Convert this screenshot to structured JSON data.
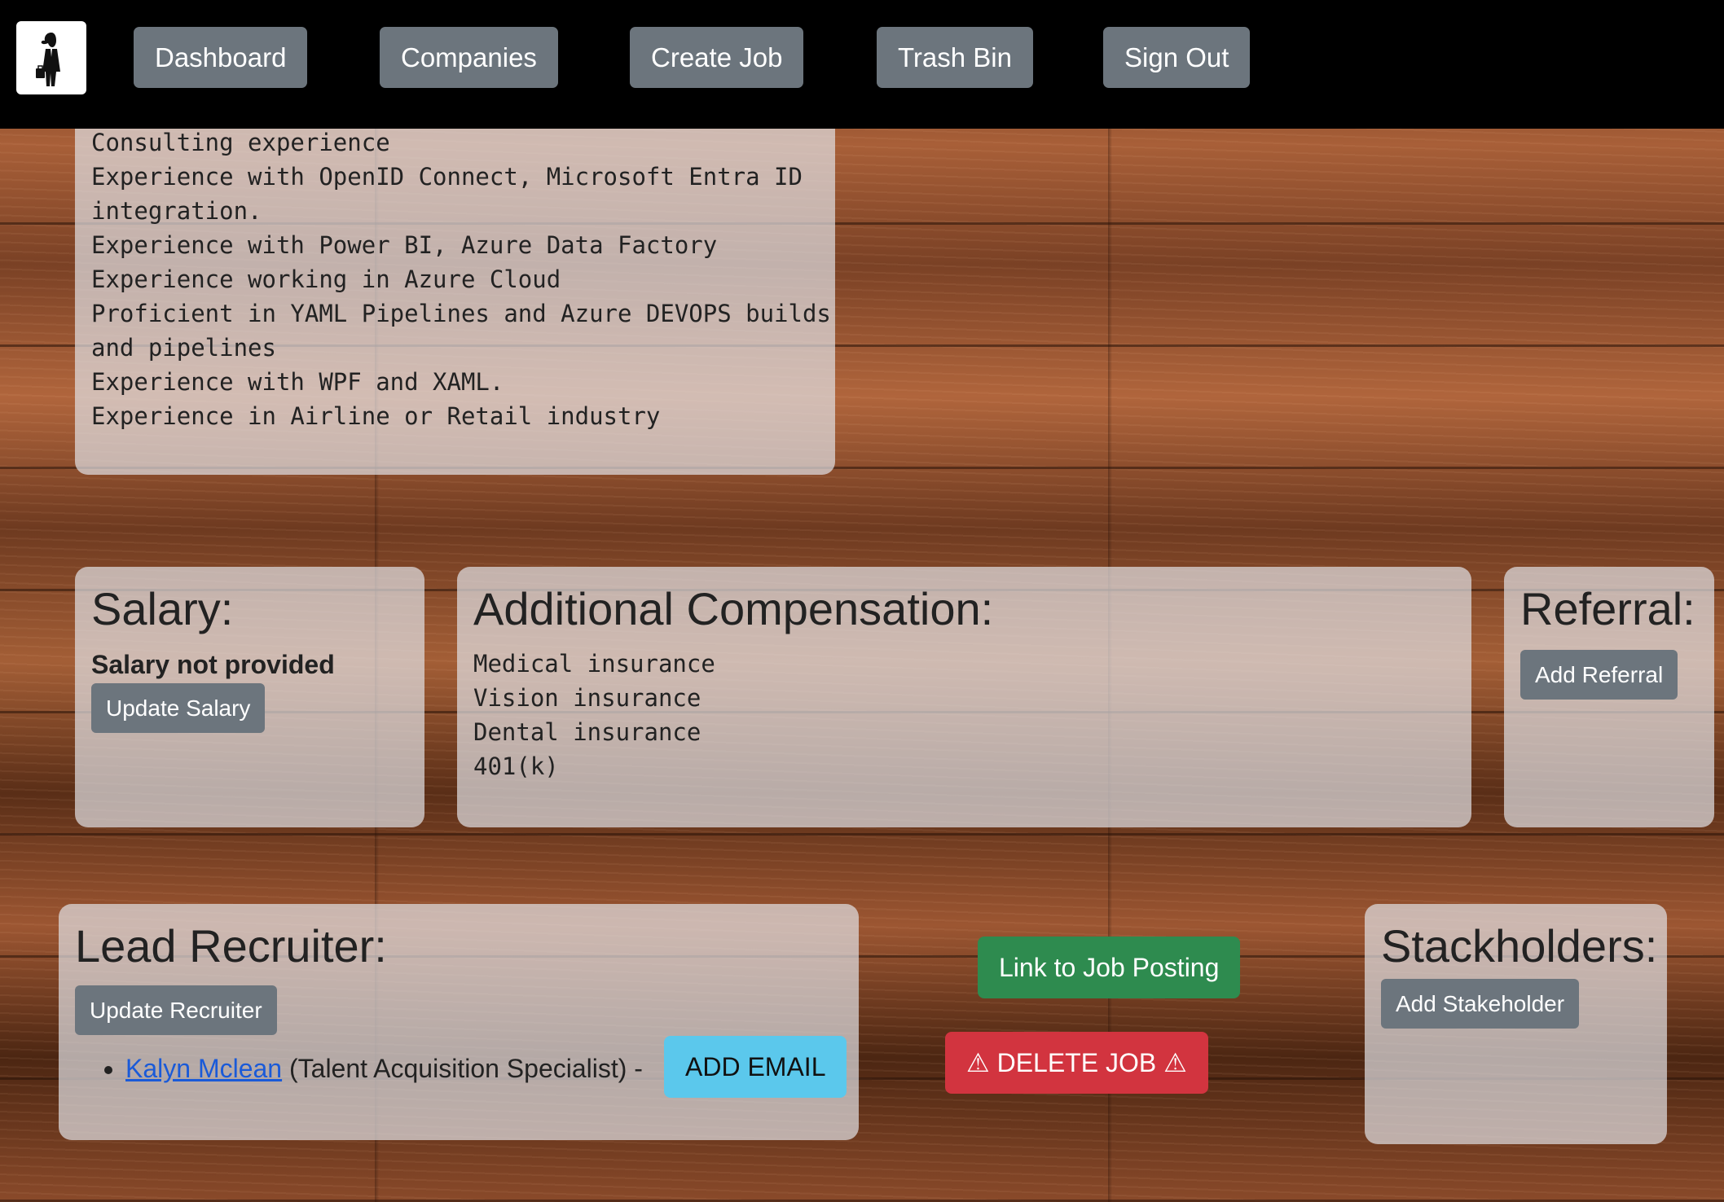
{
  "nav": {
    "logo_icon": "businessman-logo-icon",
    "items": [
      {
        "label": "Dashboard"
      },
      {
        "label": "Companies"
      },
      {
        "label": "Create Job"
      },
      {
        "label": "Trash Bin"
      },
      {
        "label": "Sign Out"
      }
    ]
  },
  "qualifications": {
    "lines": [
      "Consulting experience",
      "Experience with OpenID Connect, Microsoft Entra ID",
      "integration.",
      "Experience with Power BI, Azure Data Factory",
      "Experience working in Azure Cloud",
      "Proficient in YAML Pipelines and Azure DEVOPS builds",
      "and pipelines",
      "Experience with WPF and XAML.",
      "Experience in Airline or Retail industry"
    ]
  },
  "salary": {
    "title": "Salary:",
    "note": "Salary not provided",
    "button": "Update Salary"
  },
  "compensation": {
    "title": "Additional Compensation:",
    "items": [
      "Medical insurance",
      "Vision insurance",
      "Dental insurance",
      "401(k)"
    ]
  },
  "referral": {
    "title": "Referral:",
    "button": "Add Referral"
  },
  "recruiter": {
    "title": "Lead Recruiter:",
    "button": "Update Recruiter",
    "name": "Kalyn Mclean",
    "role": " (Talent Acquisition Specialist) -",
    "email_button": "ADD EMAIL"
  },
  "actions": {
    "link_button": "Link to Job Posting",
    "delete_button": "⚠ DELETE JOB ⚠"
  },
  "stakeholders": {
    "title": "Stackholders:",
    "button": "Add Stakeholder"
  },
  "colors": {
    "navbar": "#000000",
    "gray_button": "#6c757d",
    "green_button": "#2e8b4f",
    "red_button": "#d2343f",
    "info_button": "#5bc8ec",
    "link": "#1a5ad8"
  }
}
